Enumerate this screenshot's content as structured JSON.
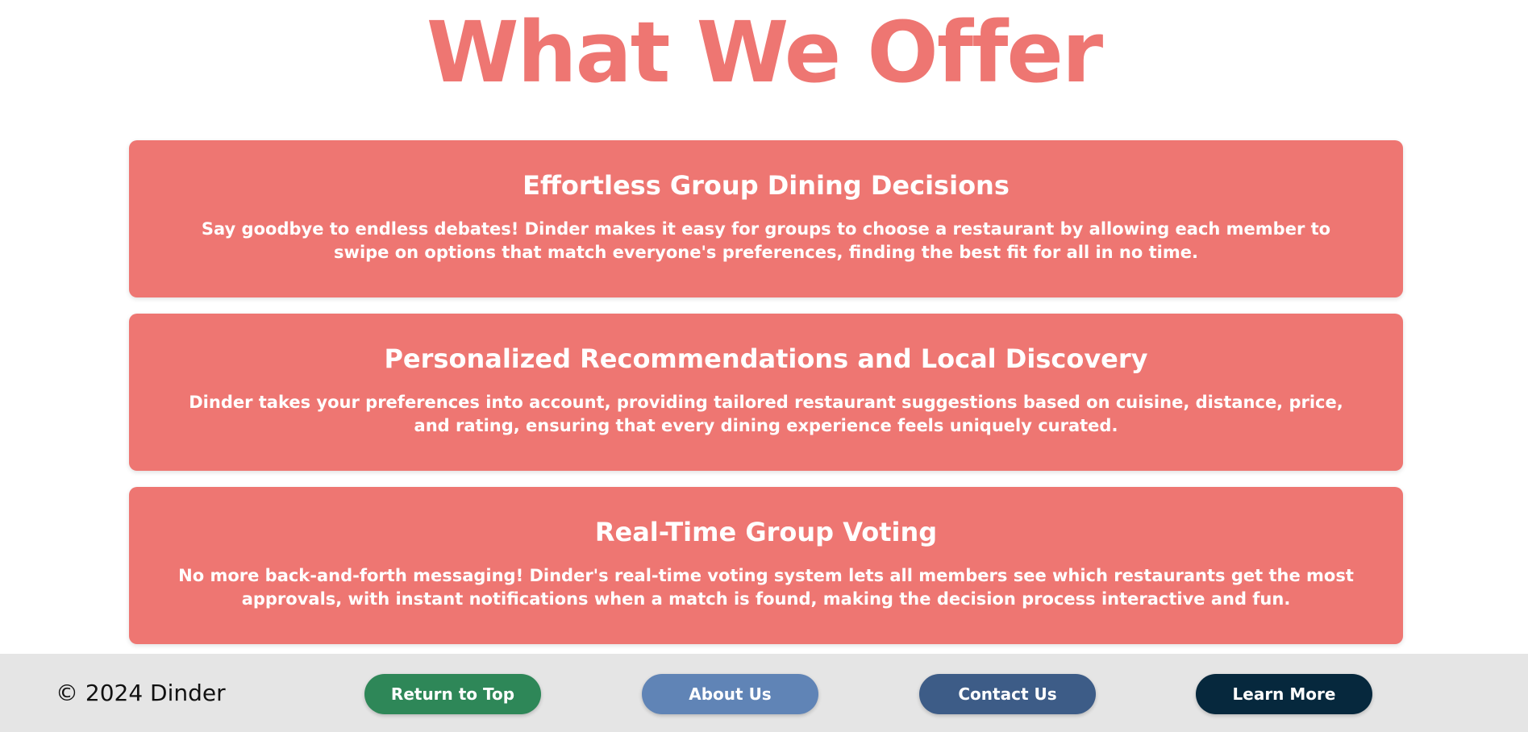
{
  "page": {
    "title": "What We Offer"
  },
  "features": [
    {
      "title": "Effortless Group Dining Decisions",
      "description": "Say goodbye to endless debates! Dinder makes it easy for groups to choose a restaurant by allowing each member to swipe on options that match everyone's preferences, finding the best fit for all in no time."
    },
    {
      "title": "Personalized Recommendations and Local Discovery",
      "description": "Dinder takes your preferences into account, providing tailored restaurant suggestions based on cuisine, distance, price, and rating, ensuring that every dining experience feels uniquely curated."
    },
    {
      "title": "Real-Time Group Voting",
      "description": "No more back-and-forth messaging! Dinder's real-time voting system lets all members see which restaurants get the most approvals, with instant notifications when a match is found, making the decision process interactive and fun."
    }
  ],
  "footer": {
    "copyright": "© 2024 Dinder",
    "buttons": {
      "return_top": "Return to Top",
      "about": "About Us",
      "contact": "Contact Us",
      "learn_more": "Learn More"
    }
  },
  "colors": {
    "accent": "#ee7672",
    "footer_bg": "#e5e5e5",
    "return_top": "#2e8758",
    "about": "#6084b6",
    "contact": "#3d5c87",
    "learn_more": "#06283d"
  }
}
